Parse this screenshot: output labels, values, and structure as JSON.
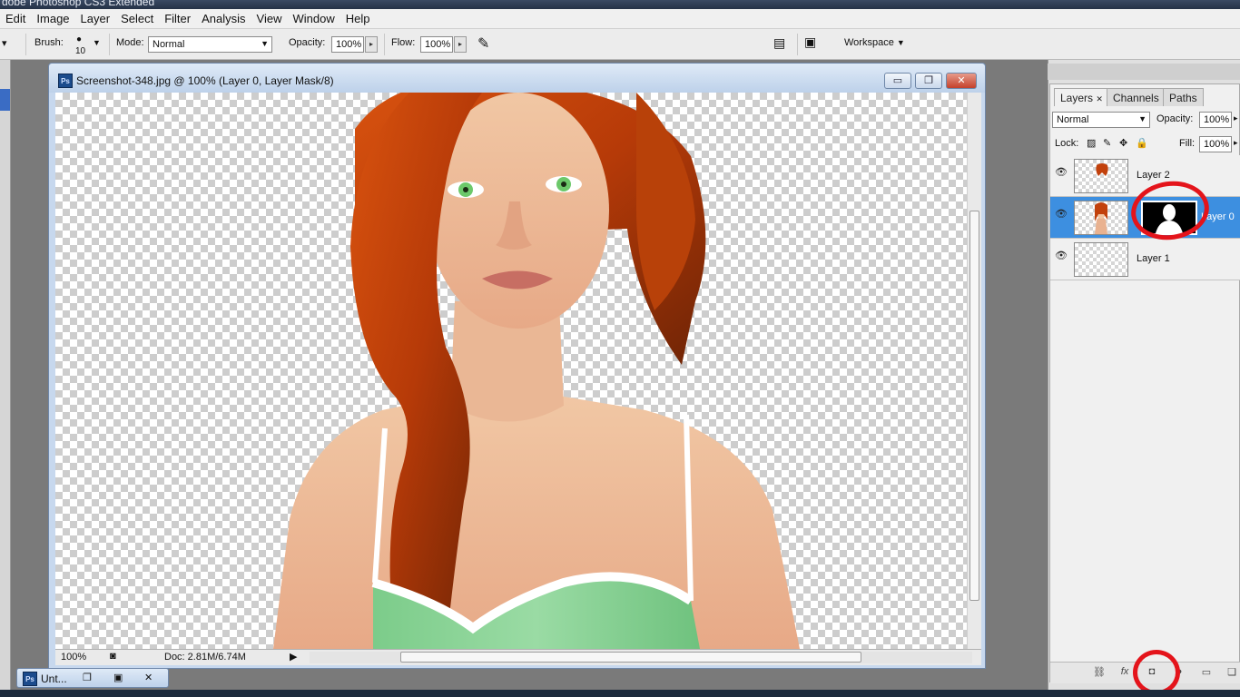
{
  "app": {
    "title": "dobe Photoshop CS3 Extended"
  },
  "menubar": {
    "items": [
      "Edit",
      "Image",
      "Layer",
      "Select",
      "Filter",
      "Analysis",
      "View",
      "Window",
      "Help"
    ]
  },
  "options": {
    "brush_label": "Brush:",
    "brush_size": "10",
    "mode_label": "Mode:",
    "mode_value": "Normal",
    "opacity_label": "Opacity:",
    "opacity_value": "100%",
    "flow_label": "Flow:",
    "flow_value": "100%",
    "workspace_label": "Workspace"
  },
  "document": {
    "title": "Screenshot-348.jpg @ 100% (Layer 0, Layer Mask/8)",
    "badge": "Ps",
    "zoom": "100%",
    "doc_size": "Doc: 2.81M/6.74M",
    "minimize": "▭",
    "restore": "❐",
    "close": "✕"
  },
  "minimized_doc": {
    "label": "Unt..."
  },
  "layers_panel": {
    "tabs": [
      "Layers",
      "Channels",
      "Paths"
    ],
    "blend_mode": "Normal",
    "opacity_label": "Opacity:",
    "opacity_value": "100%",
    "lock_label": "Lock:",
    "fill_label": "Fill:",
    "fill_value": "100%",
    "layers": [
      {
        "name": "Layer 2",
        "visible": true,
        "selected": false
      },
      {
        "name": "Layer 0",
        "visible": true,
        "selected": true
      },
      {
        "name": "Layer 1",
        "visible": true,
        "selected": false
      }
    ],
    "footer_icons": [
      "link-icon",
      "fx-icon",
      "add-mask-icon",
      "adjustment-icon",
      "group-icon",
      "new-layer-icon"
    ]
  },
  "colors": {
    "selection": "#3d8fe0",
    "annotation": "#e4141b",
    "hair": "#c2410c",
    "top": "#7fd08f"
  }
}
